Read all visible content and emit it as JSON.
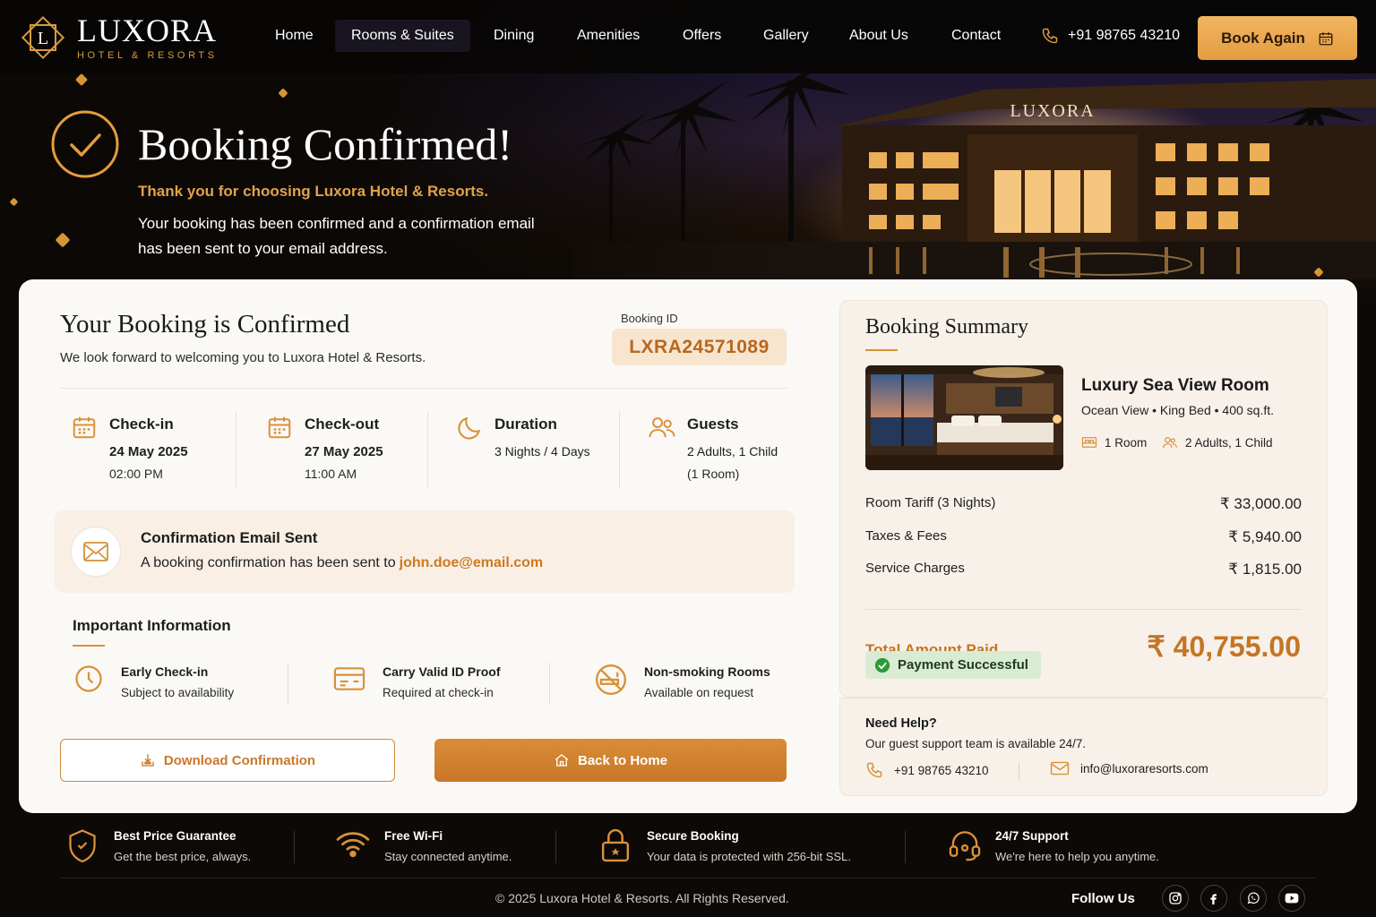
{
  "colors": {
    "accent": "#d8913a",
    "accent_dark": "#c47524",
    "gold": "#e2a24a",
    "success": "#2d9a3a",
    "card": "#fbf9f6",
    "dark": "#0c0906"
  },
  "brand": {
    "name": "LUXORA",
    "tagline": "HOTEL & RESORTS",
    "monogram": "L",
    "building_sign": "LUXORA"
  },
  "nav": {
    "items": [
      "Home",
      "Rooms & Suites",
      "Dining",
      "Amenities",
      "Offers",
      "Gallery",
      "About Us",
      "Contact"
    ],
    "phone": "+91 98765 43210",
    "cta": "Book Again",
    "icons": {
      "phone": "phone-icon",
      "calendar": "calendar-icon"
    }
  },
  "hero": {
    "title": "Booking Confirmed!",
    "thanks": "Thank you for choosing Luxora Hotel & Resorts.",
    "description": "Your booking has been confirmed and a confirmation email has been sent to your email address."
  },
  "confirmation": {
    "title": "Your Booking is Confirmed",
    "subtitle": "We look forward to welcoming you to Luxora Hotel & Resorts.",
    "booking_id_label": "Booking ID",
    "booking_id": "LXRA24571089"
  },
  "stats": {
    "checkin": {
      "title": "Check-in",
      "date": "24 May 2025",
      "time": "02:00 PM"
    },
    "checkout": {
      "title": "Check-out",
      "date": "27 May 2025",
      "time": "11:00 AM"
    },
    "duration": {
      "title": "Duration",
      "value": "3 Nights / 4 Days"
    },
    "guests": {
      "title": "Guests",
      "value": "2 Adults, 1 Child",
      "rooms": "(1 Room)"
    }
  },
  "email": {
    "title": "Confirmation Email Sent",
    "text": "A booking confirmation has been sent to",
    "address": "john.doe@email.com"
  },
  "important": {
    "title": "Important Information",
    "items": [
      {
        "title": "Early Check-in",
        "sub": "Subject to availability"
      },
      {
        "title": "Carry Valid ID Proof",
        "sub": "Required at check-in"
      },
      {
        "title": "Non-smoking Rooms",
        "sub": "Available on request"
      }
    ]
  },
  "actions": {
    "download": "Download Confirmation",
    "home": "Back to Home"
  },
  "summary": {
    "title": "Booking Summary",
    "room_name": "Luxury Sea View Room",
    "room_features": "Ocean View  •  King Bed  •  400 sq.ft.",
    "rooms": "1 Room",
    "guests": "2 Adults, 1 Child",
    "lines": [
      {
        "label": "Room Tariff (3 Nights)",
        "amount": "₹ 33,000.00"
      },
      {
        "label": "Taxes & Fees",
        "amount": "₹ 5,940.00"
      },
      {
        "label": "Service Charges",
        "amount": "₹ 1,815.00"
      }
    ],
    "total_label": "Total Amount Paid",
    "total": "₹ 40,755.00",
    "payment_status": "Payment Successful"
  },
  "help": {
    "title": "Need Help?",
    "subtitle": "Our guest support team is available 24/7.",
    "phone": "+91 98765 43210",
    "email": "info@luxoraresorts.com"
  },
  "features": [
    {
      "title": "Best Price Guarantee",
      "sub": "Get the best price, always."
    },
    {
      "title": "Free Wi-Fi",
      "sub": "Stay connected anytime."
    },
    {
      "title": "Secure Booking",
      "sub": "Your data is protected with 256-bit SSL."
    },
    {
      "title": "24/7 Support",
      "sub": "We're here to help you anytime."
    }
  ],
  "footer": {
    "copyright": "© 2025 Luxora Hotel & Resorts. All Rights Reserved.",
    "follow": "Follow Us",
    "socials": [
      "instagram-icon",
      "facebook-icon",
      "whatsapp-icon",
      "youtube-icon"
    ]
  }
}
